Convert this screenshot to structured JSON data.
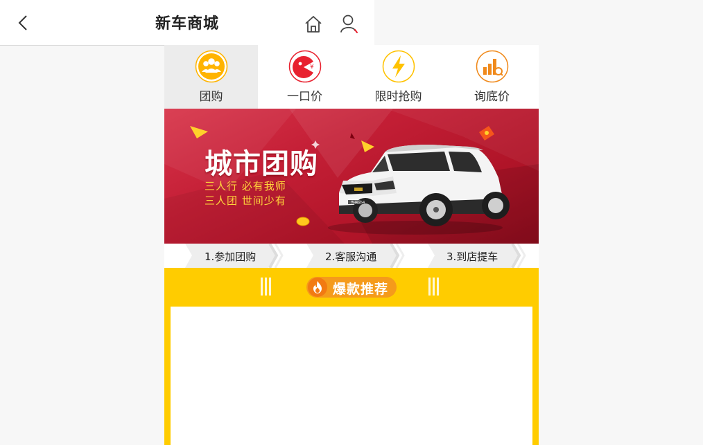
{
  "header": {
    "title": "新车商城",
    "back_icon": "chevron-left-icon",
    "home_icon": "home-icon",
    "user_icon": "user-icon"
  },
  "tabs": [
    {
      "label": "团购",
      "icon": "group-users-icon",
      "color": "#ffb400",
      "active": true
    },
    {
      "label": "一口价",
      "icon": "price-tag-icon",
      "color": "#e8212f",
      "active": false
    },
    {
      "label": "限时抢购",
      "icon": "lightning-icon",
      "color": "#ffc200",
      "active": false
    },
    {
      "label": "询底价",
      "icon": "price-inquiry-icon",
      "color": "#f08a1c",
      "active": false
    }
  ],
  "banner": {
    "title": "城市团购",
    "slogan_1": "三人行  必有我师",
    "slogan_2": "三人团  世间少有",
    "car_badge": "传祺GS4",
    "colors": {
      "primary": "#c41f36",
      "slogan": "#ffd43b"
    }
  },
  "steps": [
    "1.参加团购",
    "2.客服沟通",
    "3.到店提车"
  ],
  "hot_section": {
    "title": "爆款推荐",
    "icon": "flame-icon",
    "colors": {
      "background": "#ffcc00",
      "badge": "#f59b1b"
    }
  }
}
